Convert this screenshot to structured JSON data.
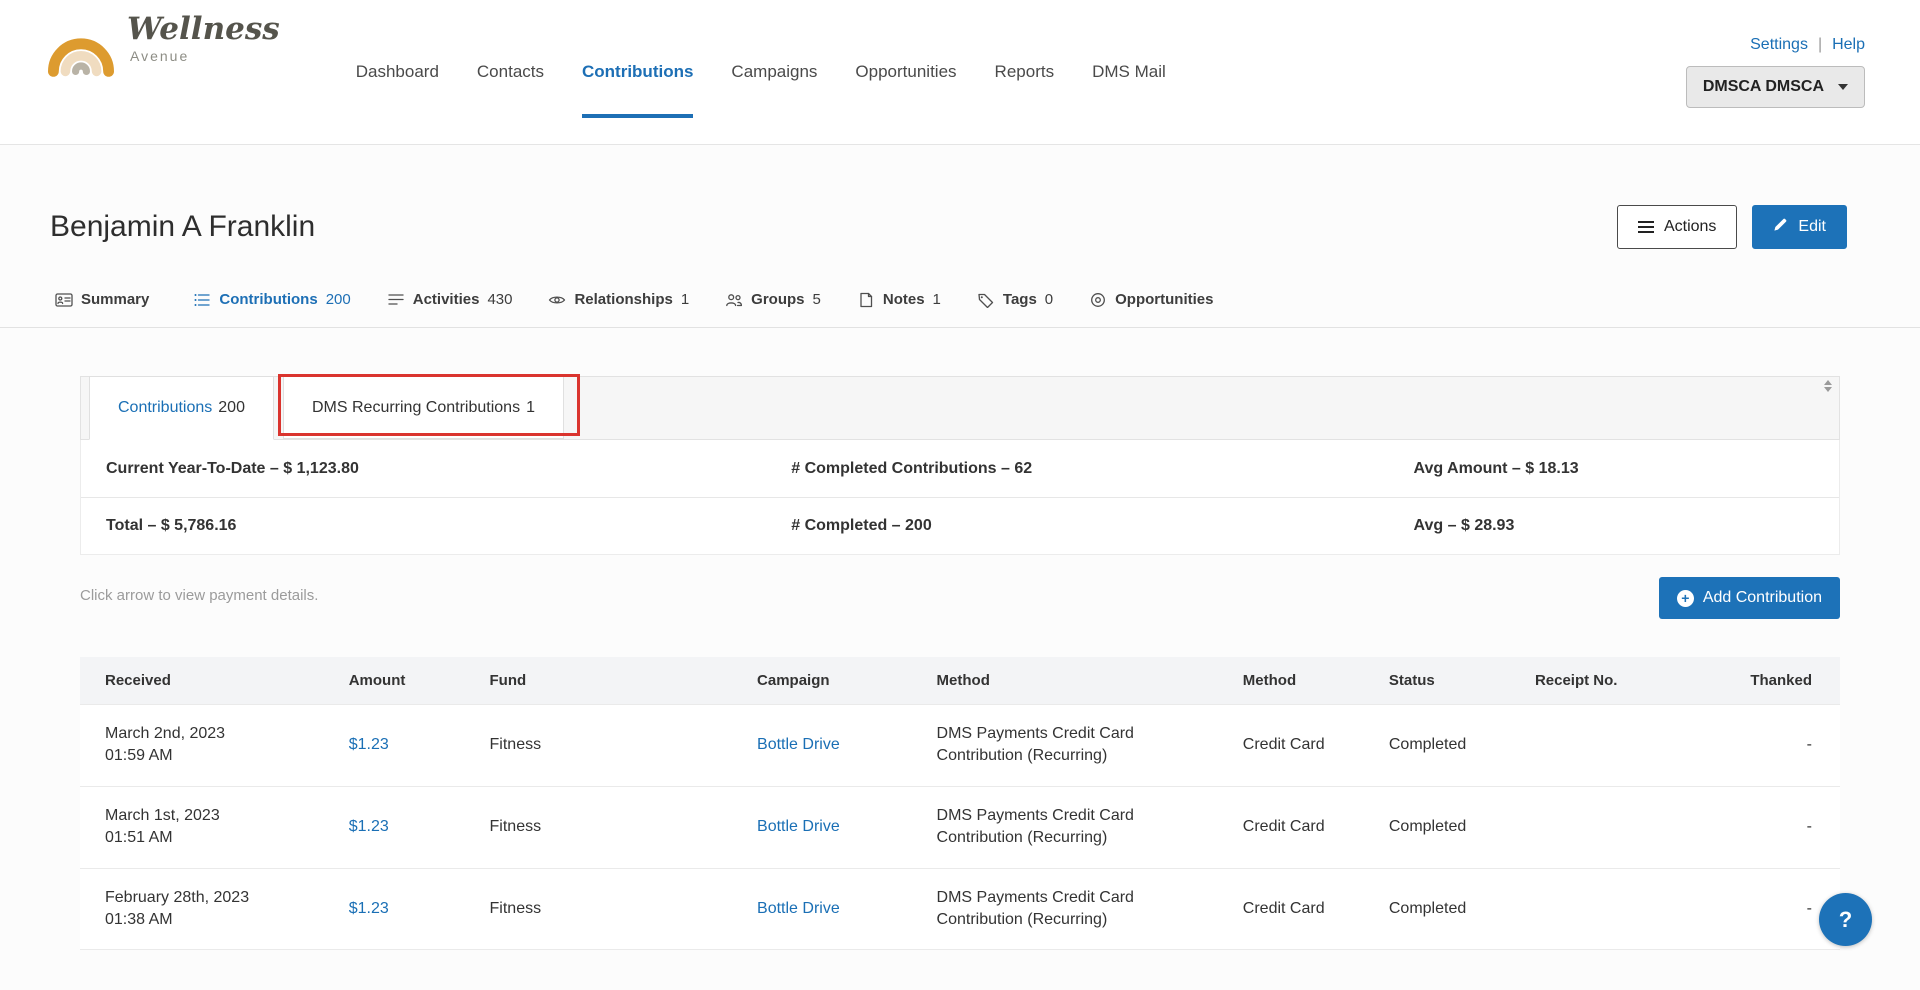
{
  "colors": {
    "accent_blue": "#1d72b8",
    "link_blue": "#1a6fb5",
    "nav_active_blue": "#1d6fb5",
    "annotation_red": "#da342e"
  },
  "brand": {
    "name_script": "Wellness",
    "name_sub": "Avenue"
  },
  "header": {
    "nav_items": [
      {
        "label": "Dashboard"
      },
      {
        "label": "Contacts"
      },
      {
        "label": "Contributions",
        "active": true
      },
      {
        "label": "Campaigns"
      },
      {
        "label": "Opportunities"
      },
      {
        "label": "Reports"
      },
      {
        "label": "DMS Mail"
      }
    ],
    "settings_label": "Settings",
    "help_label": "Help",
    "account_label": "DMSCA DMSCA"
  },
  "page": {
    "title": "Benjamin A Franklin",
    "actions_button": "Actions",
    "edit_button": "Edit"
  },
  "contact_tabs": [
    {
      "label": "Summary",
      "count": ""
    },
    {
      "label": "Contributions",
      "count": "200",
      "active": true
    },
    {
      "label": "Activities",
      "count": "430"
    },
    {
      "label": "Relationships",
      "count": "1"
    },
    {
      "label": "Groups",
      "count": "5"
    },
    {
      "label": "Notes",
      "count": "1"
    },
    {
      "label": "Tags",
      "count": "0"
    },
    {
      "label": "Opportunities",
      "count": ""
    }
  ],
  "panel": {
    "tabs": [
      {
        "label": "Contributions",
        "count": "200",
        "active": true
      },
      {
        "label": "DMS Recurring Contributions",
        "count": "1",
        "active": false,
        "highlighted": true
      }
    ],
    "stats_row1": [
      "Current Year-To-Date – $ 1,123.80",
      "# Completed Contributions – 62",
      "Avg Amount – $ 18.13"
    ],
    "stats_row2": [
      "Total – $ 5,786.16",
      "# Completed – 200",
      "Avg – $ 28.93"
    ],
    "hint": "Click arrow to view payment details.",
    "add_button": "Add Contribution"
  },
  "table": {
    "headers": [
      "Received",
      "Amount",
      "Fund",
      "Campaign",
      "Method",
      "Method",
      "Status",
      "Receipt No.",
      "Thanked"
    ],
    "rows": [
      {
        "date": "March 2nd, 2023",
        "time": "01:59 AM",
        "amount": "$1.23",
        "fund": "Fitness",
        "campaign": "Bottle Drive",
        "method_desc": "DMS Payments Credit Card Contribution (Recurring)",
        "method": "Credit Card",
        "status": "Completed",
        "receipt": "",
        "thanked": "-"
      },
      {
        "date": "March 1st, 2023",
        "time": "01:51 AM",
        "amount": "$1.23",
        "fund": "Fitness",
        "campaign": "Bottle Drive",
        "method_desc": "DMS Payments Credit Card Contribution (Recurring)",
        "method": "Credit Card",
        "status": "Completed",
        "receipt": "",
        "thanked": "-"
      },
      {
        "date": "February 28th, 2023",
        "time": "01:38 AM",
        "amount": "$1.23",
        "fund": "Fitness",
        "campaign": "Bottle Drive",
        "method_desc": "DMS Payments Credit Card Contribution (Recurring)",
        "method": "Credit Card",
        "status": "Completed",
        "receipt": "",
        "thanked": "-"
      }
    ]
  },
  "help_button": "?"
}
